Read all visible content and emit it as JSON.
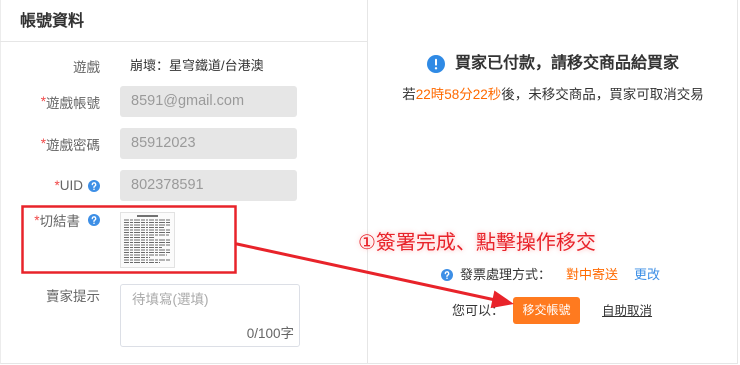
{
  "section": {
    "title": "帳號資料"
  },
  "form": {
    "game": {
      "label": "遊戲",
      "value": "崩壞：星穹鐵道/台港澳"
    },
    "account": {
      "required_mark": "*",
      "label": "遊戲帳號",
      "value": "8591@gmail.com"
    },
    "password": {
      "required_mark": "*",
      "label": "遊戲密碼",
      "value": "85912023"
    },
    "uid": {
      "required_mark": "*",
      "label": "UID",
      "value": "802378591",
      "help_icon": "question-circle-icon"
    },
    "affidavit": {
      "required_mark": "*",
      "label": "切結書",
      "help_icon": "question-circle-icon"
    },
    "seller_note": {
      "label": "賣家提示",
      "placeholder": "待填寫(選填)",
      "counter": "0/100字"
    }
  },
  "order_status": {
    "icon": "exclamation-circle-icon",
    "title": "買家已付款，請移交商品給買家",
    "deadline_prefix": "若",
    "deadline_countdown": "22時58分22秒",
    "deadline_suffix": "後，未移交商品，買家可取消交易"
  },
  "invoice": {
    "icon": "question-circle-icon",
    "label": "發票處理方式：",
    "value": "對中寄送",
    "change_link": "更改"
  },
  "actions": {
    "label": "您可以：",
    "transfer_button": "移交帳號",
    "cancel_link": "自助取消"
  },
  "annotation": {
    "text": "①簽署完成、點擊操作移交"
  },
  "colors": {
    "required": "#f04848",
    "help_icon": "#3d8fe6",
    "info_icon": "#2f8ae5",
    "link": "#3d8fe6",
    "accent": "#ff6a00",
    "button": "#ff7a1f",
    "annotation": "#e8232a"
  }
}
